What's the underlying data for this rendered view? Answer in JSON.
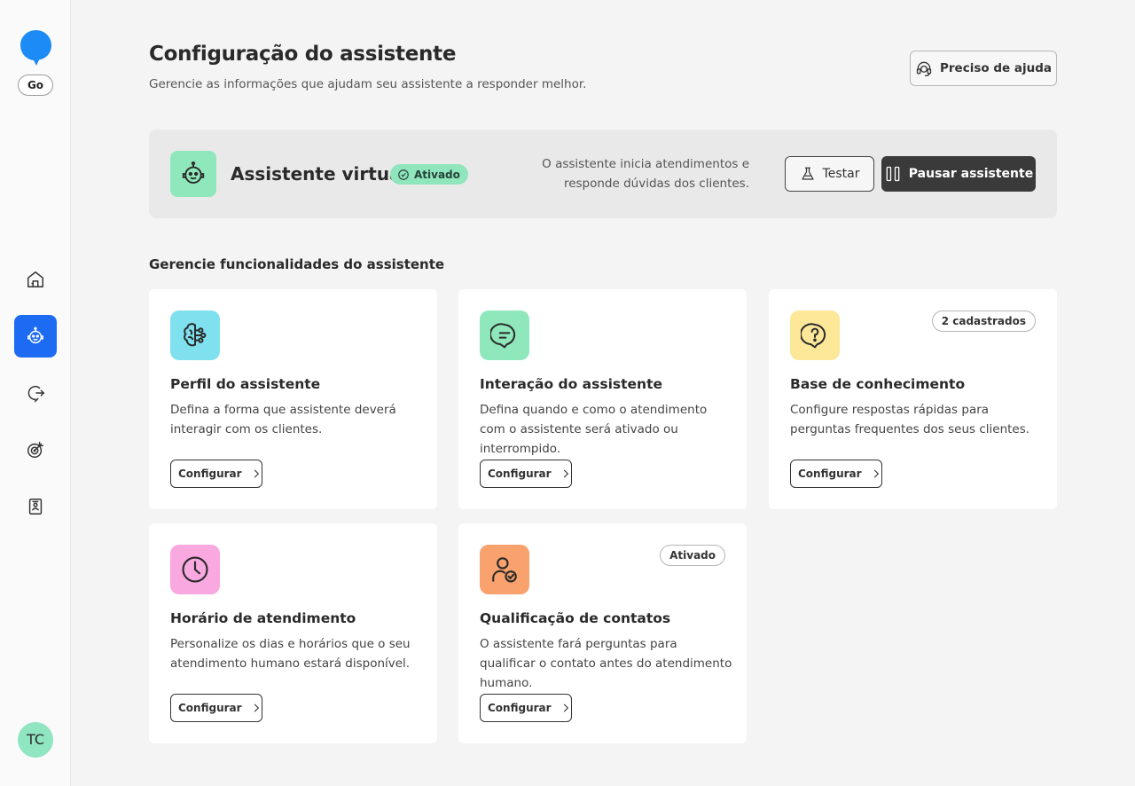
{
  "sidebar": {
    "plan_badge": "Go",
    "avatar_initials": "TC",
    "nav": [
      {
        "name": "home-icon"
      },
      {
        "name": "robot-icon",
        "active": true
      },
      {
        "name": "chat-redirect-icon"
      },
      {
        "name": "target-icon"
      },
      {
        "name": "contact-book-icon"
      }
    ]
  },
  "header": {
    "title": "Configuração do assistente",
    "subtitle": "Gerencie as informações que ajudam seu assistente a responder melhor.",
    "help_label": "Preciso de ajuda"
  },
  "banner": {
    "title": "Assistente virtual",
    "status": "Ativado",
    "desc_line1": "O assistente inicia atendimentos e",
    "desc_line2": "responde dúvidas dos clientes.",
    "test_label": "Testar",
    "pause_label": "Pausar assistente"
  },
  "section_title": "Gerencie funcionalidades do assistente",
  "cards": [
    {
      "title": "Perfil do assistente",
      "desc": "Defina a forma que assistente deverá interagir com os clientes.",
      "button": "Configurar",
      "badge": "",
      "icon": "brain-icon",
      "color": "#7fe0ee"
    },
    {
      "title": "Interação do assistente",
      "desc": "Defina quando e como o atendimento com o assistente será ativado ou interrompido.",
      "button": "Configurar",
      "badge": "",
      "icon": "chat-bubble-icon",
      "color": "#8fe8bc"
    },
    {
      "title": "Base de conhecimento",
      "desc": "Configure respostas rápidas para perguntas frequentes dos seus clientes.",
      "button": "Configurar",
      "badge": "2 cadastrados",
      "icon": "question-icon",
      "color": "#fde89a"
    },
    {
      "title": "Horário de atendimento",
      "desc": "Personalize os dias e horários que o seu atendimento humano estará disponível.",
      "button": "Configurar",
      "badge": "",
      "icon": "clock-icon",
      "color": "#f9a8e0"
    },
    {
      "title": "Qualificação de contatos",
      "desc": "O assistente fará perguntas para qualificar o contato antes do atendimento humano.",
      "button": "Configurar",
      "badge": "Ativado",
      "icon": "user-check-icon",
      "color": "#f9a26e"
    }
  ],
  "colors": {
    "primary": "#1d6bf3",
    "success": "#8fe6bc",
    "dark_button": "#3a3a3a"
  }
}
